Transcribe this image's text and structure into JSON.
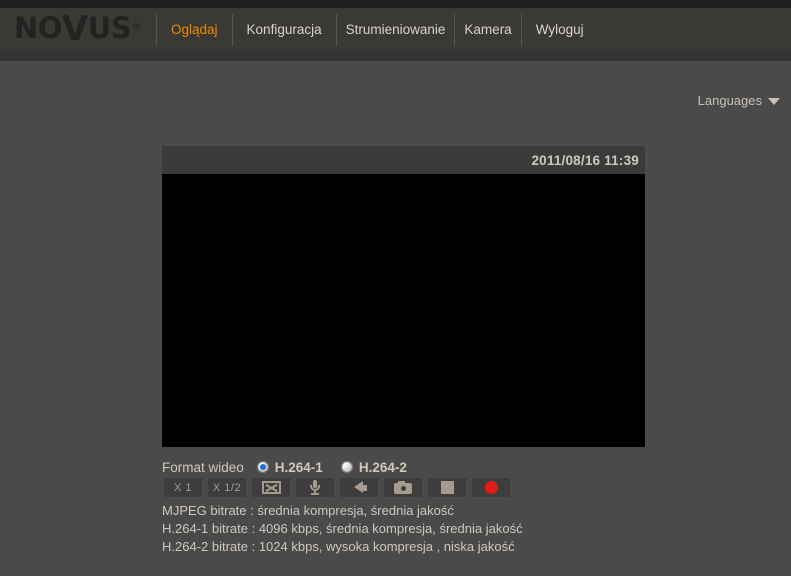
{
  "brand": {
    "logo_part1": "N",
    "logo_o": "O",
    "logo_v": "V",
    "logo_part2": "US",
    "logo_tm": "®",
    "logo_full": "NOVUS"
  },
  "nav": {
    "items": [
      {
        "label": "Oglądaj",
        "active": true
      },
      {
        "label": "Konfiguracja",
        "active": false
      },
      {
        "label": "Strumieniowanie",
        "active": false
      },
      {
        "label": "Kamera",
        "active": false
      },
      {
        "label": "Wyloguj",
        "active": false
      }
    ]
  },
  "languages": {
    "label": "Languages",
    "icon": "chevron-down-icon"
  },
  "video": {
    "timestamp": "2011/08/16 11:39",
    "stream_color": "#000000"
  },
  "format": {
    "label": "Format wideo",
    "options": [
      {
        "label": "H.264-1",
        "selected": true
      },
      {
        "label": "H.264-2",
        "selected": false
      }
    ]
  },
  "toolbar": {
    "buttons": [
      {
        "name": "zoom-x1-button",
        "kind": "text",
        "label": "X 1"
      },
      {
        "name": "zoom-x-half-button",
        "kind": "text",
        "label": "X 1/2"
      },
      {
        "name": "fullscreen-button",
        "kind": "icon",
        "icon": "expand-icon",
        "label": ""
      },
      {
        "name": "microphone-button",
        "kind": "icon",
        "icon": "microphone-icon",
        "label": ""
      },
      {
        "name": "speaker-button",
        "kind": "icon",
        "icon": "speaker-icon",
        "label": ""
      },
      {
        "name": "snapshot-button",
        "kind": "icon",
        "icon": "camera-icon",
        "label": ""
      },
      {
        "name": "stop-button",
        "kind": "icon",
        "icon": "stop-square-icon",
        "label": ""
      },
      {
        "name": "record-button",
        "kind": "icon",
        "icon": "record-circle-icon",
        "label": ""
      }
    ]
  },
  "bitrates": {
    "lines": [
      "MJPEG bitrate : średnia kompresja, średnia jakość",
      "H.264-1 bitrate : 4096 kbps, średnia kompresja, średnia jakość",
      "H.264-2 bitrate : 1024 kbps, wysoka kompresja , niska jakość"
    ]
  },
  "colors": {
    "accent_orange": "#f08a00",
    "header_bg": "#3b3936",
    "page_bg": "#4a4a4a",
    "text": "#cfc8bd",
    "record_red": "#e21b1b",
    "radio_blue": "#1a6fd4"
  }
}
